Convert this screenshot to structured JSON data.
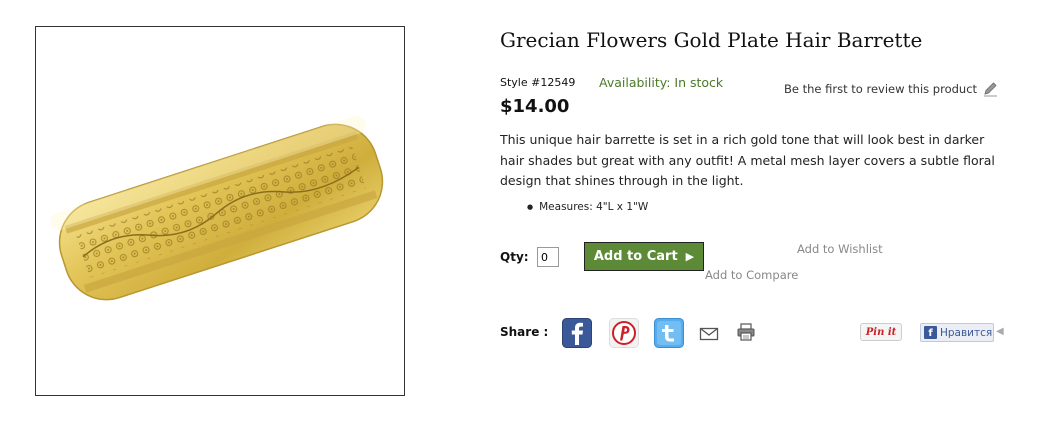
{
  "product": {
    "title": "Grecian Flowers Gold Plate Hair Barrette",
    "style": "Style #12549",
    "availability": "Availability: In stock",
    "review_link": "Be the first to review this product",
    "price": "$14.00",
    "description": "This unique hair barrette is set in a rich gold tone that will look best in darker hair shades but great with any outfit! A metal mesh layer covers a subtle floral design that shines through in the light.",
    "features": [
      "Measures: 4\"L x 1\"W"
    ]
  },
  "purchase": {
    "qty_label": "Qty:",
    "qty_value": "0",
    "add_to_cart": "Add to Cart",
    "add_to_wishlist": "Add to Wishlist",
    "add_to_compare": "Add to Compare"
  },
  "share": {
    "label": "Share :",
    "icons": [
      "facebook-icon",
      "pinterest-icon",
      "twitter-icon",
      "email-icon",
      "print-icon"
    ],
    "pinit_label": "Pin it",
    "fb_like_label": "Нравится"
  },
  "colors": {
    "availability": "#4a7a2a",
    "cart_button": "#5c8a36",
    "gold": "#d9b948"
  }
}
